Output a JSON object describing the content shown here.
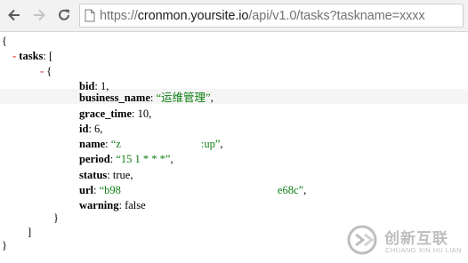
{
  "toolbar": {
    "back_icon": "back-arrow-icon",
    "forward_icon": "forward-arrow-icon",
    "reload_icon": "reload-icon",
    "page_icon": "page-icon"
  },
  "address_bar": {
    "scheme": "https://",
    "host": "cronmon.yoursite.io",
    "path": "/api/v1.0/tasks?taskname=xxxx"
  },
  "json_view": {
    "open_brace": "{",
    "toggle": "-",
    "tasks_key": "tasks",
    "open_bracket": "[",
    "item_open": "{",
    "fields": {
      "bid_key": "bid",
      "bid_value": "1",
      "business_name_key": "business_name",
      "business_name_value": "“运维管理”",
      "grace_time_key": "grace_time",
      "grace_time_value": "10",
      "id_key": "id",
      "id_value": "6",
      "name_key": "name",
      "name_value_start": "“z",
      "name_value_end": ":up”",
      "period_key": "period",
      "period_value": "“15 1 * * *”",
      "status_key": "status",
      "status_value": "true",
      "url_key": "url",
      "url_value_start": "“b98",
      "url_value_end": "e68c”",
      "warning_key": "warning",
      "warning_value": "false"
    },
    "item_close": "}",
    "close_bracket": "]",
    "close_brace": "}"
  },
  "watermark": {
    "text_cn": "创新互联",
    "text_en": "CHUANG XIN HU LIAN"
  },
  "colors": {
    "toggle_red": "#e0292b",
    "string_green": "#0e7f13",
    "highlight_row": "#f5f5f5"
  }
}
